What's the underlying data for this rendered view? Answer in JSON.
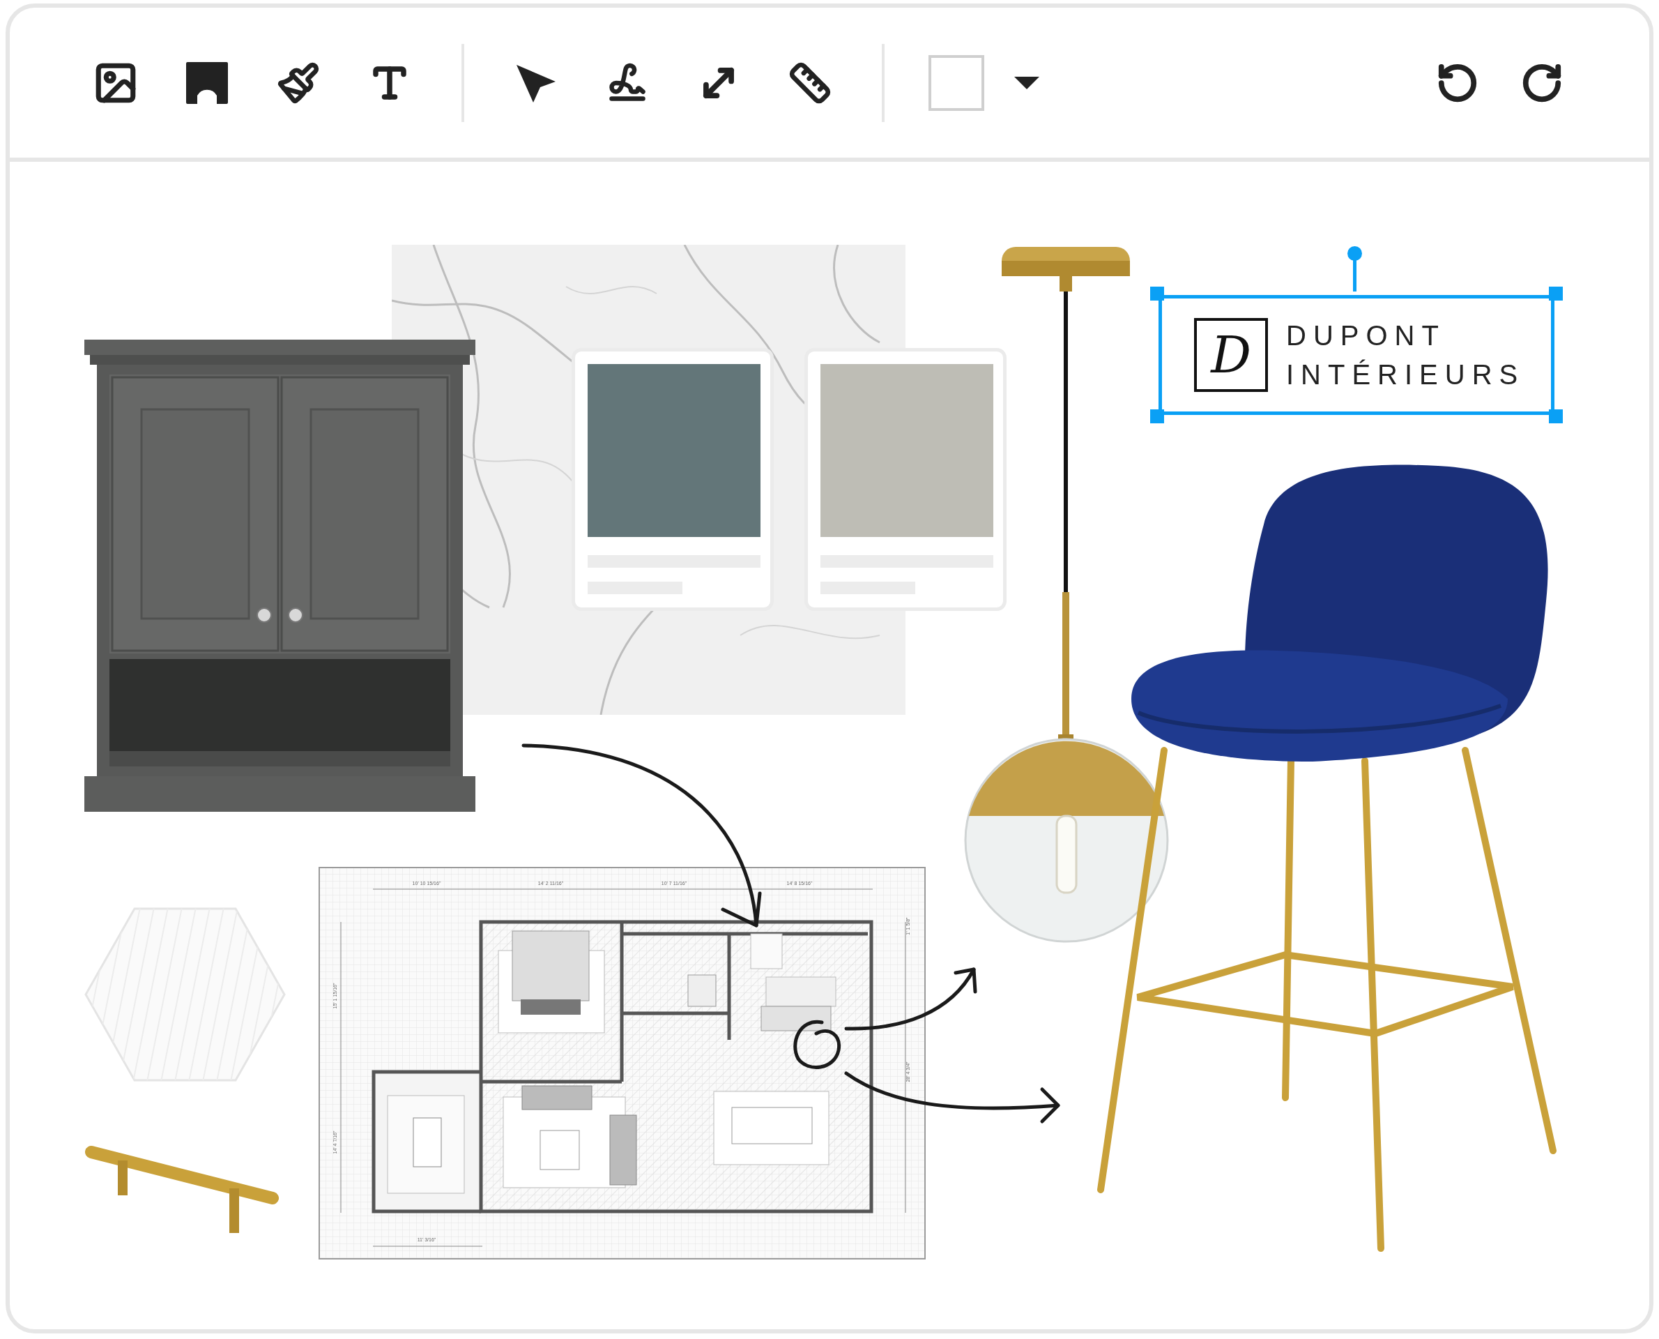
{
  "swatches": [
    {
      "color": "#637679"
    },
    {
      "color": "#bebdb5"
    }
  ],
  "logo": {
    "monogram": "D",
    "lines": [
      "DUPONT",
      "INTÉRIEURS"
    ],
    "selected": true
  },
  "floor_plan": {
    "dimensions": {
      "top": [
        "10' 10 15/16\"",
        "14' 2 11/16\"",
        "10' 7 11/16\"",
        "14' 8 15/16\""
      ],
      "left": [
        "15' 1 15/16\"",
        "14' 4 7/16\""
      ],
      "right": [
        "1' 1 5/8\"",
        "28' 4 3/4\""
      ],
      "bottom": [
        "11' 3/16\""
      ]
    }
  }
}
